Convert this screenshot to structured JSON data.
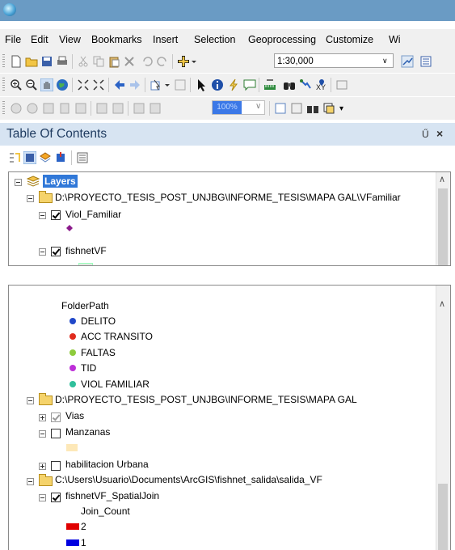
{
  "menu": [
    "File",
    "Edit",
    "View",
    "Bookmarks",
    "Insert",
    "Selection",
    "Geoprocessing",
    "Customize",
    "Wi"
  ],
  "toolbar": {
    "scale": "1:30,000",
    "zoom_percent": "100%"
  },
  "toc": {
    "title": "Table Of Contents",
    "pin_glyph": "Ű",
    "close_glyph": "×",
    "top_items": {
      "layers": "Layers",
      "folder1": "D:\\PROYECTO_TESIS_POST_UNJBG\\INFORME_TESIS\\MAPA GAL\\VFamiliar",
      "viol_familiar": "Viol_Familiar",
      "fishnet": "fishnetVF"
    },
    "bottom_items": {
      "folder_path_header": "FolderPath",
      "classes": [
        {
          "label": "DELITO",
          "color": "#2148c9"
        },
        {
          "label": "ACC TRANSITO",
          "color": "#e02b1d"
        },
        {
          "label": "FALTAS",
          "color": "#8ecb3c"
        },
        {
          "label": "TID",
          "color": "#bd2fd8"
        },
        {
          "label": "VIOL FAMILIAR",
          "color": "#2fbf9b"
        }
      ],
      "folder2": "D:\\PROYECTO_TESIS_POST_UNJBG\\INFORME_TESIS\\MAPA GAL",
      "vias": "Vias",
      "manzanas": "Manzanas",
      "manzanas_color": "#fde8b8",
      "habilitacion": "habilitacion Urbana",
      "folder3": "C:\\Users\\Usuario\\Documents\\ArcGIS\\fishnet_salida\\salida_VF",
      "spatial_join": "fishnetVF_SpatialJoin",
      "join_count_header": "Join_Count",
      "join_classes": [
        {
          "label": "2",
          "color": "#e00000"
        },
        {
          "label": "1",
          "color": "#0000e0"
        }
      ]
    }
  },
  "colors": {
    "titlebar": "#6a9bc4",
    "toc_header": "#d7e4f2",
    "viol_point": "#8b1a8b"
  }
}
